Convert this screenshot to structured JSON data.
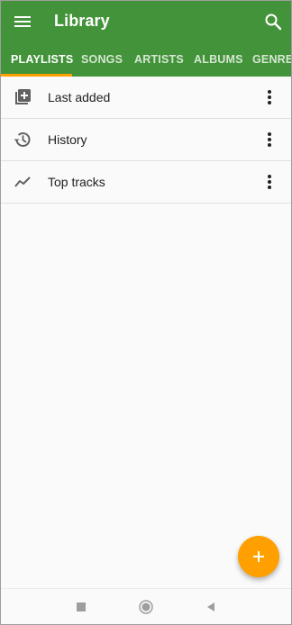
{
  "app": {
    "title": "Library",
    "primary_color": "#43933a",
    "accent_color": "#ffa000"
  },
  "toolbar": {
    "menu_icon": "hamburger-menu-icon",
    "search_icon": "search-icon"
  },
  "tabs": [
    {
      "label": "PLAYLISTS",
      "active": true
    },
    {
      "label": "SONGS",
      "active": false
    },
    {
      "label": "ARTISTS",
      "active": false
    },
    {
      "label": "ALBUMS",
      "active": false
    },
    {
      "label": "GENRES",
      "active": false
    }
  ],
  "playlists": [
    {
      "label": "Last added",
      "icon": "playlist-add-icon"
    },
    {
      "label": "History",
      "icon": "history-icon"
    },
    {
      "label": "Top tracks",
      "icon": "trending-up-icon"
    }
  ],
  "fab": {
    "icon": "plus-icon"
  },
  "navbar": {
    "items": [
      "recents-square-icon",
      "home-circle-icon",
      "back-triangle-icon"
    ]
  }
}
